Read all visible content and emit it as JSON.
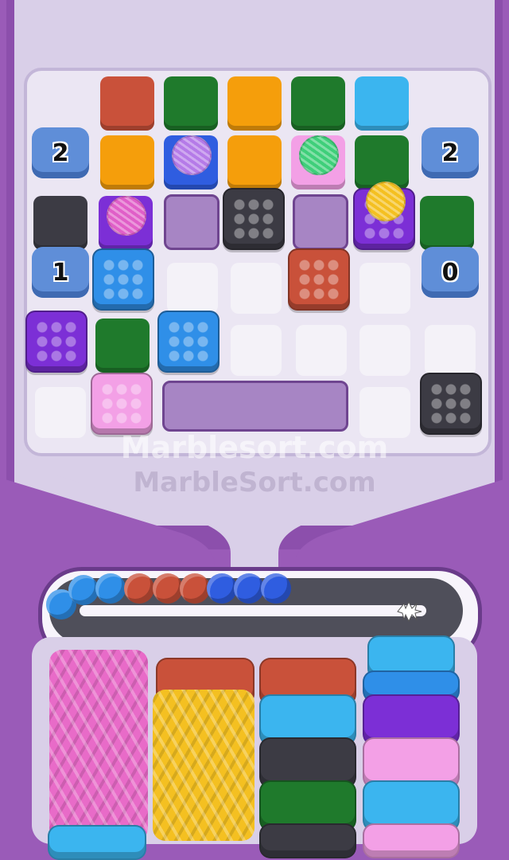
{
  "colors": {
    "red": "#c9513a",
    "green": "#1f7a2c",
    "orange": "#f59e0b",
    "sky": "#3bb5ef",
    "blue": "#2f5de0",
    "purple": "#7c2fd6",
    "pink": "#f3a0e6",
    "dark": "#3c3b44",
    "yellow": "#f4c021",
    "magenta": "#d93fc0"
  },
  "cannons": {
    "left_top": "2",
    "left_mid": "1",
    "right_top": "2",
    "right_mid": "0"
  },
  "watermarks": {
    "primary": "Marblesort.com",
    "secondary": "MarbleSort.com"
  },
  "belt": {
    "balls": [
      "sky",
      "sky",
      "sky",
      "red",
      "red",
      "red",
      "blue",
      "blue",
      "blue"
    ]
  },
  "yarn_balls": [
    "purple",
    "green",
    "magenta",
    "yellow"
  ],
  "icons": {
    "yarn": "yarn-ball-icon",
    "spike": "spike-icon",
    "box": "marble-box-icon"
  }
}
